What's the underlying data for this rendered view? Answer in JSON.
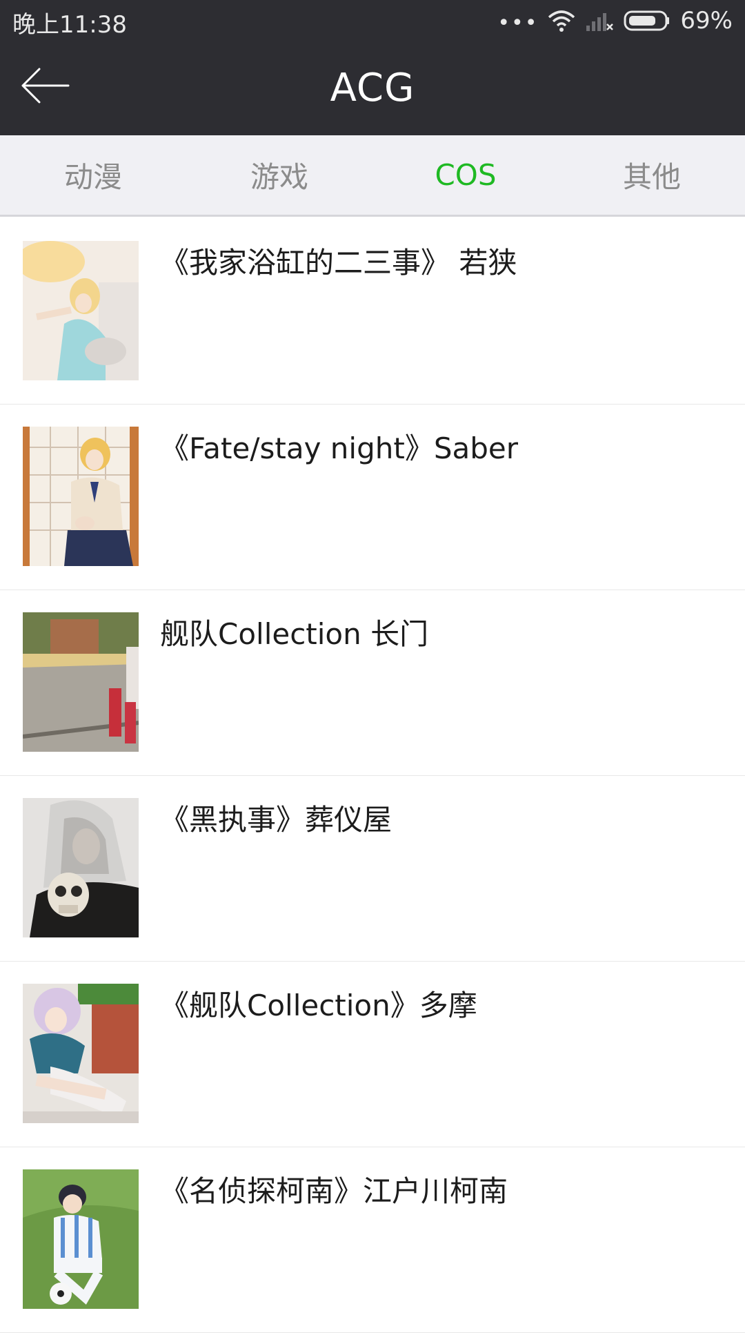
{
  "status_bar": {
    "time": "晚上11:38",
    "battery": "69%",
    "icons": [
      "more-dots-icon",
      "wifi-icon",
      "signal-icon",
      "battery-icon"
    ]
  },
  "app_bar": {
    "title": "ACG",
    "back_icon": "arrow-left-icon"
  },
  "tabs": [
    {
      "label": "动漫",
      "active": false
    },
    {
      "label": "游戏",
      "active": false
    },
    {
      "label": "COS",
      "active": true
    },
    {
      "label": "其他",
      "active": false
    }
  ],
  "colors": {
    "bar_background": "#2d2d32",
    "tab_background": "#f0f0f4",
    "active_tab": "#1fb923",
    "inactive_tab": "#8b8b8b"
  },
  "items": [
    {
      "title": "《我家浴缸的二三事》 若狭",
      "thumbnail": "cosplay-photo-bath"
    },
    {
      "title": "《Fate/stay night》Saber",
      "thumbnail": "cosplay-photo-saber"
    },
    {
      "title": "舰队Collection 长门",
      "thumbnail": "cosplay-photo-street"
    },
    {
      "title": "《黑执事》葬仪屋",
      "thumbnail": "cosplay-photo-skull"
    },
    {
      "title": "《舰队Collection》多摩",
      "thumbnail": "cosplay-photo-sailor"
    },
    {
      "title": "《名侦探柯南》江户川柯南",
      "thumbnail": "cosplay-photo-soccer"
    }
  ]
}
